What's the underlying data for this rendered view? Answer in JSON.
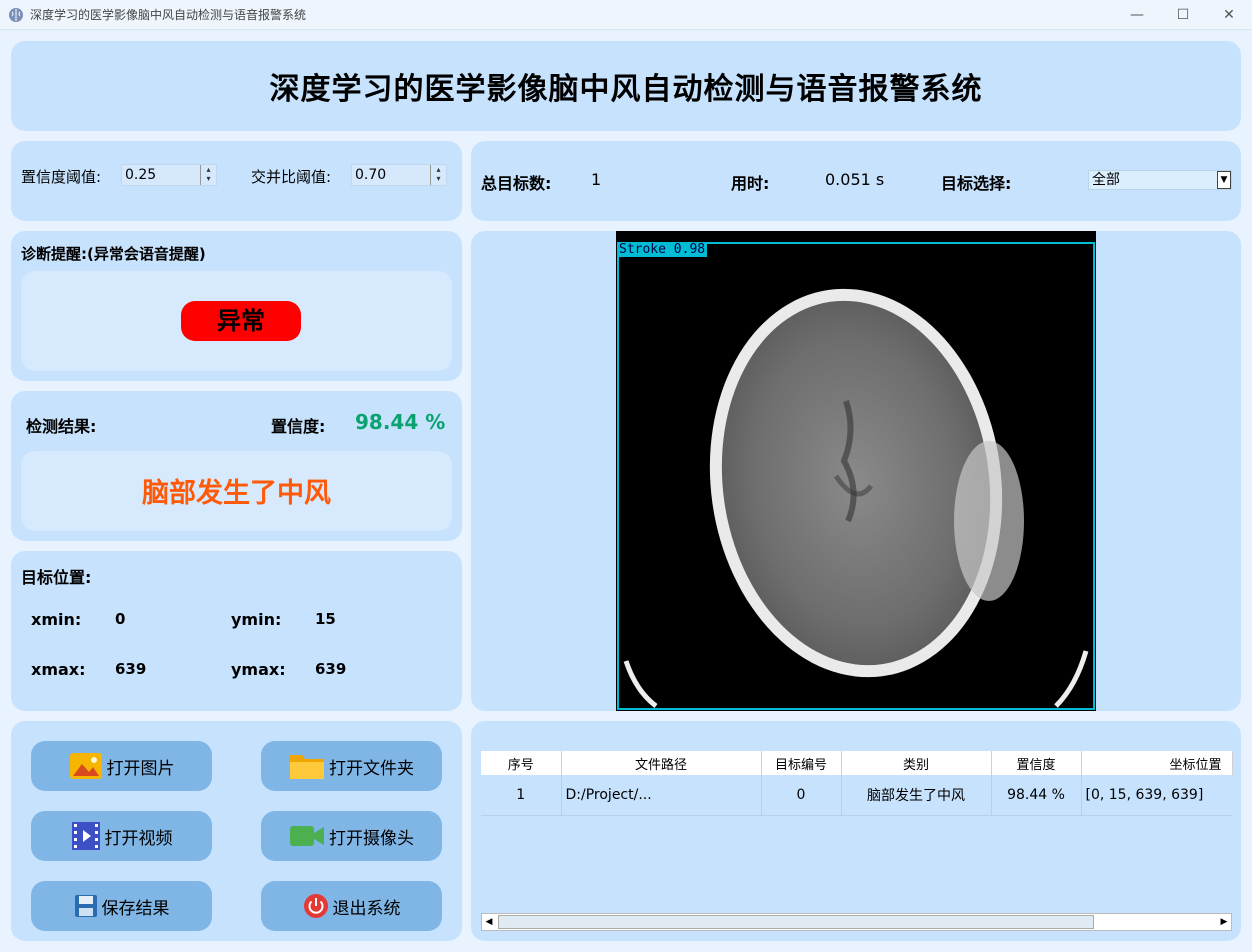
{
  "window": {
    "title": "深度学习的医学影像脑中风自动检测与语音报警系统"
  },
  "header": {
    "title": "深度学习的医学影像脑中风自动检测与语音报警系统"
  },
  "thresholds": {
    "conf_label": "置信度阈值:",
    "conf_value": "0.25",
    "iou_label": "交并比阈值:",
    "iou_value": "0.70"
  },
  "stats": {
    "total_label": "总目标数:",
    "total_value": "1",
    "time_label": "用时:",
    "time_value": "0.051 s",
    "target_label": "目标选择:",
    "target_value": "全部"
  },
  "diagnosis": {
    "label": "诊断提醒:(异常会语音提醒)",
    "status": "异常",
    "status_color": "#ff0000"
  },
  "result": {
    "label": "检测结果:",
    "conf_label": "置信度:",
    "conf_value": "98.44 %",
    "text": "脑部发生了中风",
    "text_color": "#ff5a0a"
  },
  "position": {
    "label": "目标位置:",
    "xmin_label": "xmin:",
    "xmin": "0",
    "ymin_label": "ymin:",
    "ymin": "15",
    "xmax_label": "xmax:",
    "xmax": "639",
    "ymax_label": "ymax:",
    "ymax": "639"
  },
  "detection": {
    "label": "Stroke  0.98",
    "box_color": "#00bcd4"
  },
  "buttons": {
    "open_image": "打开图片",
    "open_folder": "打开文件夹",
    "open_video": "打开视频",
    "open_camera": "打开摄像头",
    "save": "保存结果",
    "exit": "退出系统"
  },
  "table": {
    "headers": [
      "序号",
      "文件路径",
      "目标编号",
      "类别",
      "置信度",
      "坐标位置"
    ],
    "rows": [
      [
        "1",
        "D:/Project/...",
        "0",
        "脑部发生了中风",
        "98.44 %",
        "[0, 15, 639, 639]"
      ]
    ]
  }
}
